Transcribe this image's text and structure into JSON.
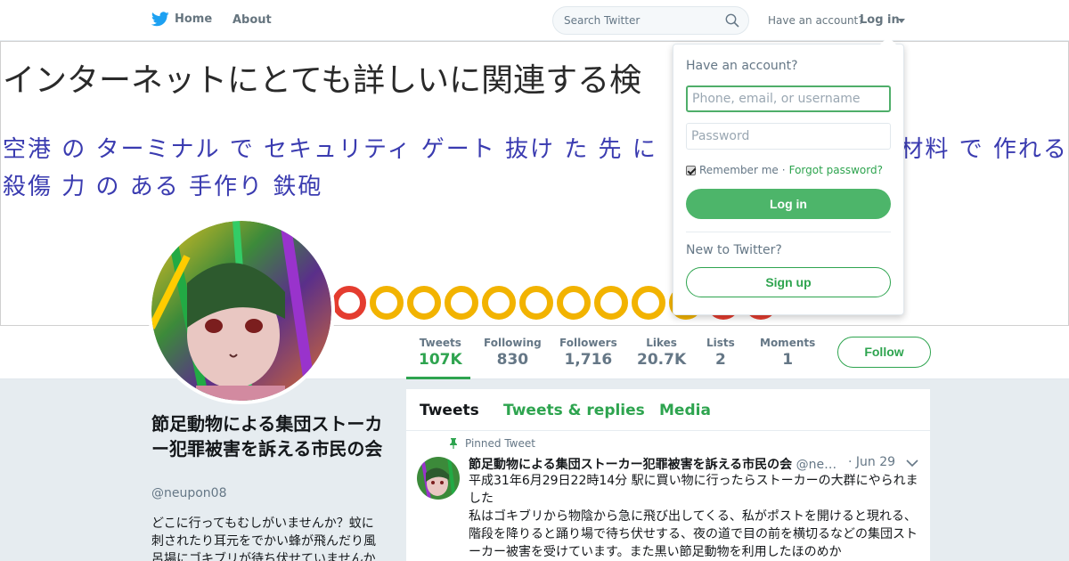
{
  "colors": {
    "accent": "#2ea44f",
    "twitter_blue": "#1da1f2",
    "background": "#e6ecf0"
  },
  "nav": {
    "home_label": "Home",
    "about_label": "About",
    "search_placeholder": "Search Twitter",
    "have_account": "Have an account?",
    "login_label": "Log in"
  },
  "banner": {
    "line1": "インターネットにとても詳しいに関連する検",
    "line2": "空港 の ターミナル で セキュリティ ゲート 抜け た 先 に 　　　　　　　　　 材料 で 作れる 殺傷 力 の ある 手作り 鉄砲"
  },
  "stats": [
    {
      "label": "Tweets",
      "value": "107K"
    },
    {
      "label": "Following",
      "value": "830"
    },
    {
      "label": "Followers",
      "value": "1,716"
    },
    {
      "label": "Likes",
      "value": "20.7K"
    },
    {
      "label": "Lists",
      "value": "2"
    },
    {
      "label": "Moments",
      "value": "1"
    }
  ],
  "follow_label": "Follow",
  "profile": {
    "name": "節足動物による集団ストーカー犯罪被害を訴える市民の会",
    "handle": "@neupon08",
    "bio": "どこに行ってもむしがいませんか？蚊に刺されたり耳元をでかい蜂が飛んだり風呂場にゴキブリが待ち伏せていませんか"
  },
  "timeline": {
    "tabs": [
      "Tweets",
      "Tweets & replies",
      "Media"
    ],
    "pinned_label": "Pinned Tweet",
    "tweet": {
      "author": "節足動物による集団ストーカー犯罪被害を訴える市民の会",
      "handle": "@ne…",
      "date": "· Jun 29",
      "text_line1": "平成31年6月29日22時14分 駅に買い物に行ったらストーカーの大群にやられました",
      "text_line2": "私はゴキブリから物陰から急に飛び出してくる、私がポストを開けると現れる、階段を降りると踊り場で待ち伏せする、夜の道で目の前を横切るなどの集団ストーカー被害を受けています。また黒い節足動物を利用したほのめか"
    }
  },
  "login_dropdown": {
    "title": "Have an account?",
    "username_placeholder": "Phone, email, or username",
    "password_placeholder": "Password",
    "remember_label": "Remember me",
    "separator": " · ",
    "forgot_label": "Forgot password?",
    "login_button": "Log in",
    "new_label": "New to Twitter?",
    "signup_button": "Sign up"
  }
}
